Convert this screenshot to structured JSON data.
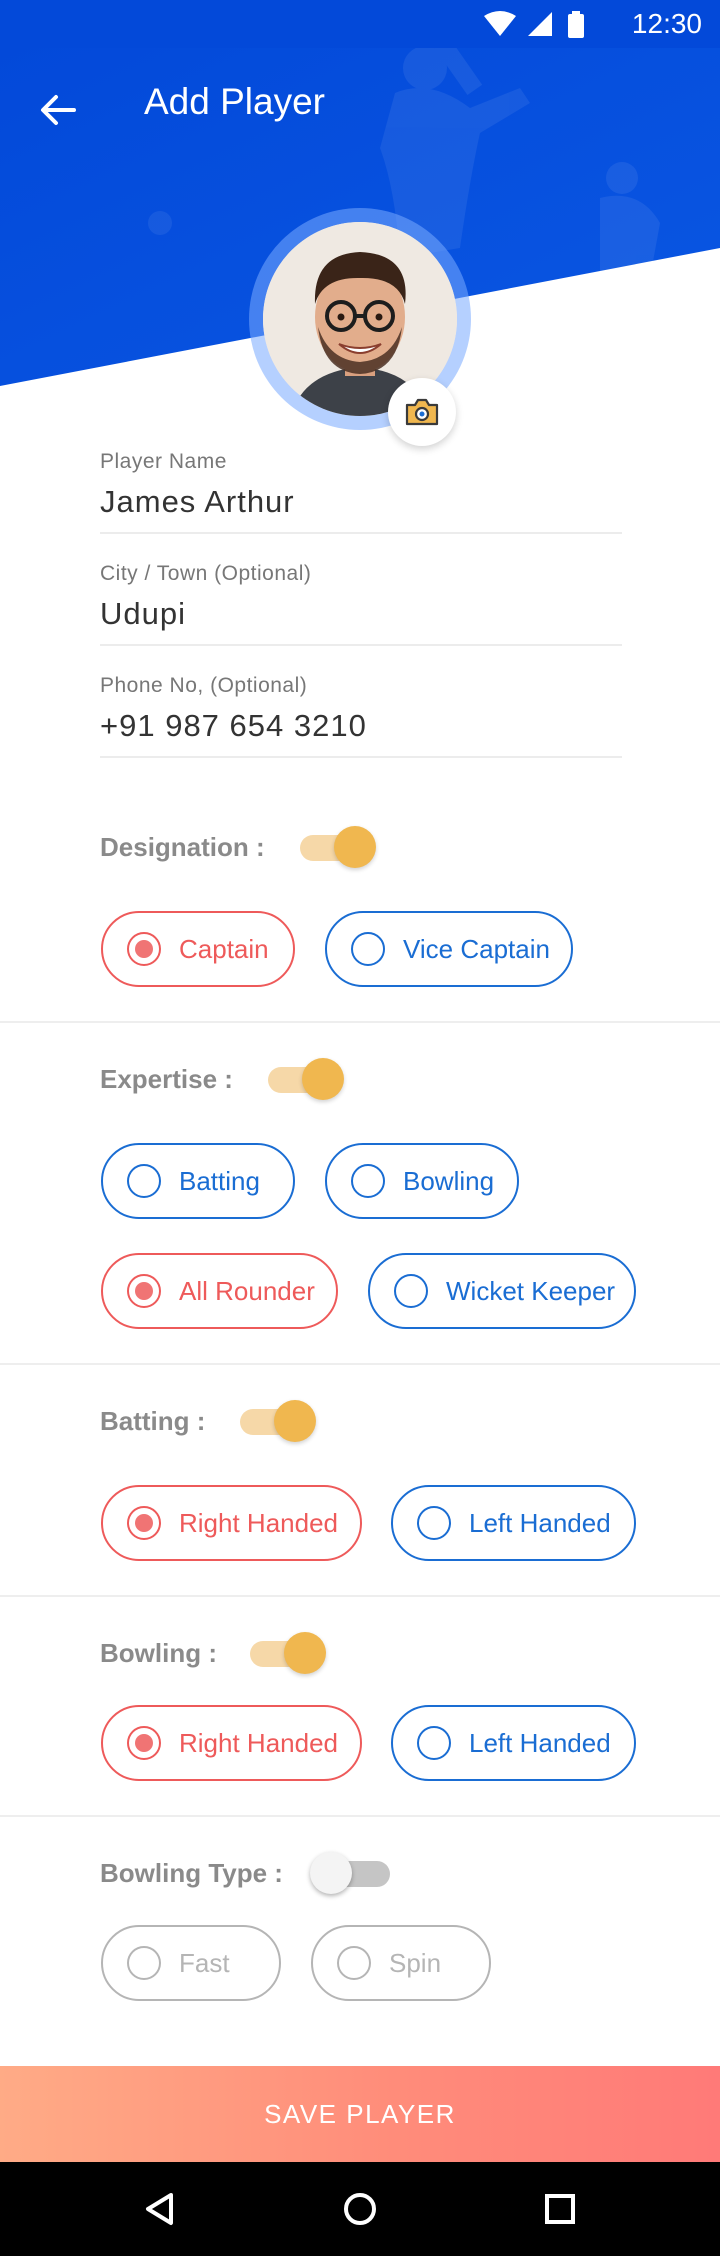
{
  "status_bar": {
    "time": "12:30"
  },
  "header": {
    "title": "Add Player"
  },
  "form": {
    "player_name": {
      "label": "Player Name",
      "value": "James Arthur"
    },
    "city": {
      "label": "City / Town (Optional)",
      "value": "Udupi"
    },
    "phone": {
      "label": "Phone No, (Optional)",
      "value": "+91 987 654 3210"
    }
  },
  "sections": {
    "designation": {
      "label": "Designation :",
      "toggle": true,
      "options": [
        "Captain",
        "Vice Captain"
      ],
      "selected": "Captain"
    },
    "expertise": {
      "label": "Expertise :",
      "toggle": true,
      "options": [
        "Batting",
        "Bowling",
        "All Rounder",
        "Wicket Keeper"
      ],
      "selected": "All Rounder"
    },
    "batting": {
      "label": "Batting :",
      "toggle": true,
      "options": [
        "Right Handed",
        "Left Handed"
      ],
      "selected": "Right Handed"
    },
    "bowling": {
      "label": "Bowling :",
      "toggle": true,
      "options": [
        "Right Handed",
        "Left Handed"
      ],
      "selected": "Right Handed"
    },
    "bowling_type": {
      "label": "Bowling Type :",
      "toggle": false,
      "options": [
        "Fast",
        "Spin"
      ],
      "selected": null
    }
  },
  "save_button": {
    "label": "SAVE PLAYER"
  },
  "colors": {
    "primary_blue": "#0349D9",
    "option_blue": "#1A6DD3",
    "selected_red": "#EE5A5A",
    "toggle_orange": "#F0B74F",
    "button_gradient_start": "#FFAB86",
    "button_gradient_end": "#FF7A78"
  },
  "icons": {
    "back": "arrow-left-icon",
    "camera": "camera-icon",
    "wifi": "wifi-icon",
    "signal": "signal-icon",
    "battery": "battery-icon",
    "nav_back": "triangle-back-icon",
    "nav_home": "circle-home-icon",
    "nav_recents": "square-recents-icon"
  }
}
